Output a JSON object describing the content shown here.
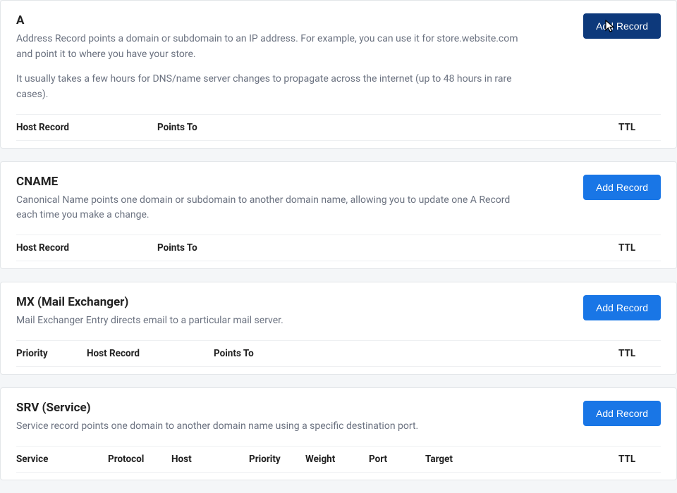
{
  "common": {
    "add_label": "Add Record"
  },
  "a": {
    "title": "A",
    "desc1": "Address Record points a domain or subdomain to an IP address. For example, you can use it for store.website.com and point it to where you have your store.",
    "desc2": "It usually takes a few hours for DNS/name server changes to propagate across the internet (up to 48 hours in rare cases).",
    "cols": {
      "host": "Host Record",
      "points": "Points To",
      "ttl": "TTL"
    }
  },
  "cname": {
    "title": "CNAME",
    "desc": "Canonical Name points one domain or subdomain to another domain name, allowing you to update one A Record each time you make a change.",
    "cols": {
      "host": "Host Record",
      "points": "Points To",
      "ttl": "TTL"
    }
  },
  "mx": {
    "title": "MX (Mail Exchanger)",
    "desc": "Mail Exchanger Entry directs email to a particular mail server.",
    "cols": {
      "priority": "Priority",
      "host": "Host Record",
      "points": "Points To",
      "ttl": "TTL"
    }
  },
  "srv": {
    "title": "SRV (Service)",
    "desc": "Service record points one domain to another domain name using a specific destination port.",
    "cols": {
      "service": "Service",
      "protocol": "Protocol",
      "host": "Host",
      "priority": "Priority",
      "weight": "Weight",
      "port": "Port",
      "target": "Target",
      "ttl": "TTL"
    }
  }
}
